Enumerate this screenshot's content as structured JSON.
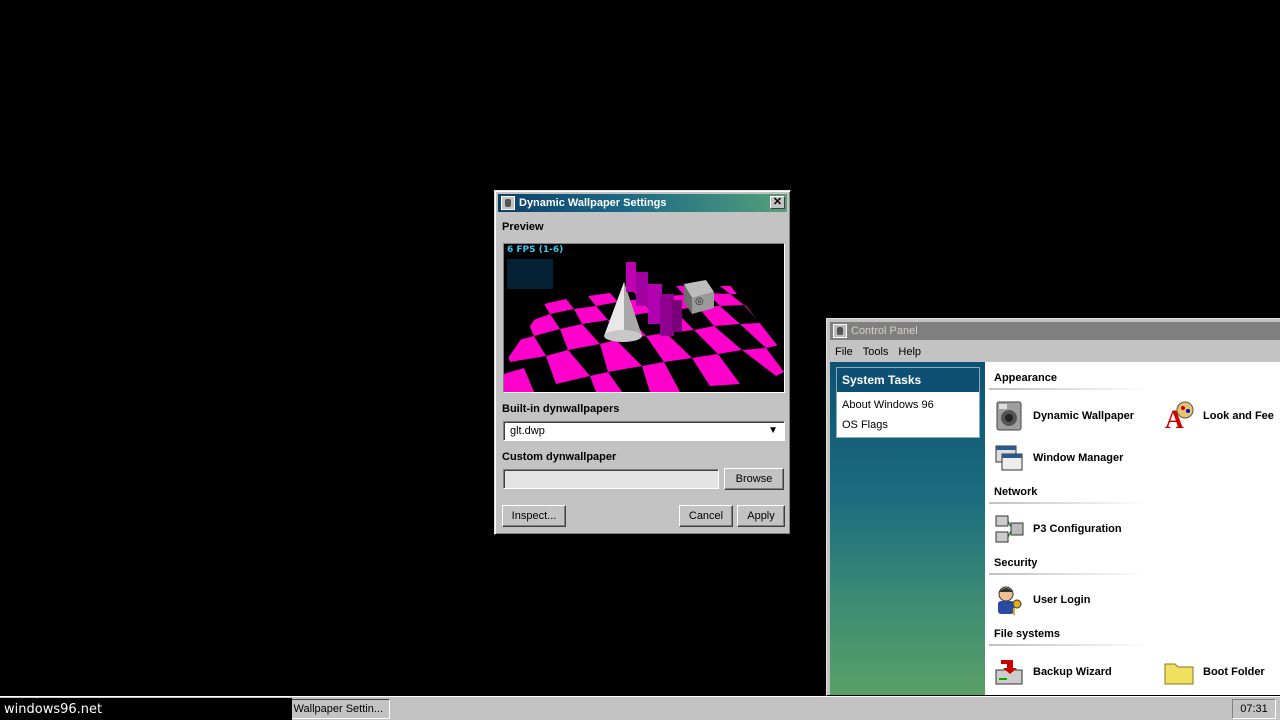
{
  "dynamic_wallpaper_dialog": {
    "title": "Dynamic Wallpaper Settings",
    "preview_label": "Preview",
    "fps_text": "6 FPS (1-6)",
    "builtin_label": "Built-in dynwallpapers",
    "builtin_selected": "glt.dwp",
    "custom_label": "Custom dynwallpaper",
    "custom_value": "",
    "browse_label": "Browse",
    "inspect_label": "Inspect...",
    "cancel_label": "Cancel",
    "apply_label": "Apply",
    "close_glyph": "✕",
    "accent_title_gradient": [
      "#0c3f6b",
      "#54a07a"
    ],
    "checker_color": "#ff00cc"
  },
  "control_panel": {
    "title": "Control Panel",
    "menu": [
      "File",
      "Tools",
      "Help"
    ],
    "system_tasks": {
      "header": "System Tasks",
      "items": [
        "About Windows 96",
        "OS Flags"
      ]
    },
    "sections": [
      {
        "title": "Appearance",
        "items": [
          {
            "label": "Dynamic Wallpaper",
            "icon": "speaker-wallpaper-icon"
          },
          {
            "label": "Look and Fee",
            "icon": "paint-palette-icon"
          },
          {
            "label": "Window Manager",
            "icon": "window-stack-icon"
          }
        ]
      },
      {
        "title": "Network",
        "items": [
          {
            "label": "P3 Configuration",
            "icon": "network-computers-icon"
          }
        ]
      },
      {
        "title": "Security",
        "items": [
          {
            "label": "User Login",
            "icon": "user-key-icon"
          }
        ]
      },
      {
        "title": "File systems",
        "items": [
          {
            "label": "Backup Wizard",
            "icon": "backup-drive-icon"
          },
          {
            "label": "Boot Folder",
            "icon": "folder-icon"
          }
        ]
      }
    ]
  },
  "taskbar": {
    "status_url": "windows96.net",
    "task_button": "Dynamic Wallpaper Settin...",
    "clock": "07:31"
  }
}
